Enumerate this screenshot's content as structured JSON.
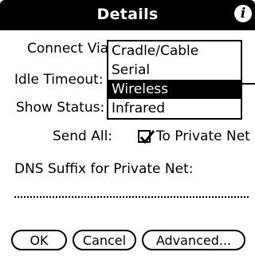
{
  "title_bar": {
    "title": "Details",
    "info_icon": "i"
  },
  "form": {
    "connect_via_label": "Connect Via:",
    "idle_timeout_label": "Idle Timeout:",
    "show_status_label": "Show Status:",
    "connect_options": [
      "Cradle/Cable",
      "Serial",
      "Wireless",
      "Infrared"
    ],
    "selected_option": "Wireless",
    "send_all_label": "Send All:",
    "send_all_checked": true,
    "send_all_checkbox_label": "To Private Net",
    "dns_suffix_label": "DNS Suffix for Private Net:",
    "dns_suffix_value": ""
  },
  "buttons": {
    "ok": "OK",
    "cancel": "Cancel",
    "advanced": "Advanced..."
  }
}
